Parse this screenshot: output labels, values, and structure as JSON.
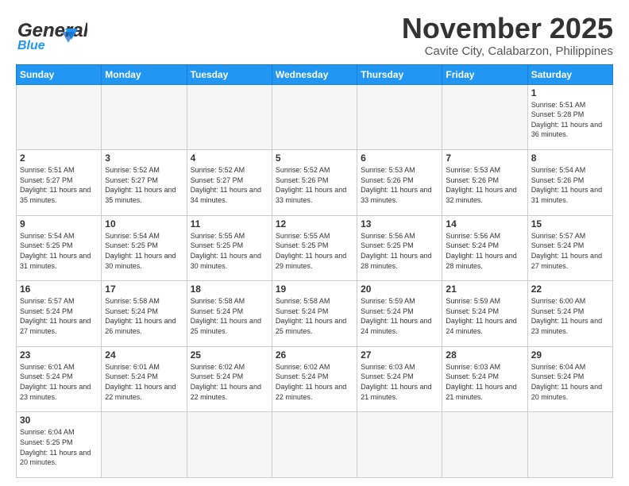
{
  "header": {
    "logo_general": "General",
    "logo_blue": "Blue",
    "month": "November 2025",
    "location": "Cavite City, Calabarzon, Philippines"
  },
  "days_of_week": [
    "Sunday",
    "Monday",
    "Tuesday",
    "Wednesday",
    "Thursday",
    "Friday",
    "Saturday"
  ],
  "weeks": [
    [
      {
        "day": "",
        "sunrise": "",
        "sunset": "",
        "daylight": "",
        "empty": true
      },
      {
        "day": "",
        "sunrise": "",
        "sunset": "",
        "daylight": "",
        "empty": true
      },
      {
        "day": "",
        "sunrise": "",
        "sunset": "",
        "daylight": "",
        "empty": true
      },
      {
        "day": "",
        "sunrise": "",
        "sunset": "",
        "daylight": "",
        "empty": true
      },
      {
        "day": "",
        "sunrise": "",
        "sunset": "",
        "daylight": "",
        "empty": true
      },
      {
        "day": "",
        "sunrise": "",
        "sunset": "",
        "daylight": "",
        "empty": true
      },
      {
        "day": "1",
        "sunrise": "Sunrise: 5:51 AM",
        "sunset": "Sunset: 5:28 PM",
        "daylight": "Daylight: 11 hours and 36 minutes.",
        "empty": false
      }
    ],
    [
      {
        "day": "2",
        "sunrise": "Sunrise: 5:51 AM",
        "sunset": "Sunset: 5:27 PM",
        "daylight": "Daylight: 11 hours and 35 minutes.",
        "empty": false
      },
      {
        "day": "3",
        "sunrise": "Sunrise: 5:52 AM",
        "sunset": "Sunset: 5:27 PM",
        "daylight": "Daylight: 11 hours and 35 minutes.",
        "empty": false
      },
      {
        "day": "4",
        "sunrise": "Sunrise: 5:52 AM",
        "sunset": "Sunset: 5:27 PM",
        "daylight": "Daylight: 11 hours and 34 minutes.",
        "empty": false
      },
      {
        "day": "5",
        "sunrise": "Sunrise: 5:52 AM",
        "sunset": "Sunset: 5:26 PM",
        "daylight": "Daylight: 11 hours and 33 minutes.",
        "empty": false
      },
      {
        "day": "6",
        "sunrise": "Sunrise: 5:53 AM",
        "sunset": "Sunset: 5:26 PM",
        "daylight": "Daylight: 11 hours and 33 minutes.",
        "empty": false
      },
      {
        "day": "7",
        "sunrise": "Sunrise: 5:53 AM",
        "sunset": "Sunset: 5:26 PM",
        "daylight": "Daylight: 11 hours and 32 minutes.",
        "empty": false
      },
      {
        "day": "8",
        "sunrise": "Sunrise: 5:54 AM",
        "sunset": "Sunset: 5:26 PM",
        "daylight": "Daylight: 11 hours and 31 minutes.",
        "empty": false
      }
    ],
    [
      {
        "day": "9",
        "sunrise": "Sunrise: 5:54 AM",
        "sunset": "Sunset: 5:25 PM",
        "daylight": "Daylight: 11 hours and 31 minutes.",
        "empty": false
      },
      {
        "day": "10",
        "sunrise": "Sunrise: 5:54 AM",
        "sunset": "Sunset: 5:25 PM",
        "daylight": "Daylight: 11 hours and 30 minutes.",
        "empty": false
      },
      {
        "day": "11",
        "sunrise": "Sunrise: 5:55 AM",
        "sunset": "Sunset: 5:25 PM",
        "daylight": "Daylight: 11 hours and 30 minutes.",
        "empty": false
      },
      {
        "day": "12",
        "sunrise": "Sunrise: 5:55 AM",
        "sunset": "Sunset: 5:25 PM",
        "daylight": "Daylight: 11 hours and 29 minutes.",
        "empty": false
      },
      {
        "day": "13",
        "sunrise": "Sunrise: 5:56 AM",
        "sunset": "Sunset: 5:25 PM",
        "daylight": "Daylight: 11 hours and 28 minutes.",
        "empty": false
      },
      {
        "day": "14",
        "sunrise": "Sunrise: 5:56 AM",
        "sunset": "Sunset: 5:24 PM",
        "daylight": "Daylight: 11 hours and 28 minutes.",
        "empty": false
      },
      {
        "day": "15",
        "sunrise": "Sunrise: 5:57 AM",
        "sunset": "Sunset: 5:24 PM",
        "daylight": "Daylight: 11 hours and 27 minutes.",
        "empty": false
      }
    ],
    [
      {
        "day": "16",
        "sunrise": "Sunrise: 5:57 AM",
        "sunset": "Sunset: 5:24 PM",
        "daylight": "Daylight: 11 hours and 27 minutes.",
        "empty": false
      },
      {
        "day": "17",
        "sunrise": "Sunrise: 5:58 AM",
        "sunset": "Sunset: 5:24 PM",
        "daylight": "Daylight: 11 hours and 26 minutes.",
        "empty": false
      },
      {
        "day": "18",
        "sunrise": "Sunrise: 5:58 AM",
        "sunset": "Sunset: 5:24 PM",
        "daylight": "Daylight: 11 hours and 25 minutes.",
        "empty": false
      },
      {
        "day": "19",
        "sunrise": "Sunrise: 5:58 AM",
        "sunset": "Sunset: 5:24 PM",
        "daylight": "Daylight: 11 hours and 25 minutes.",
        "empty": false
      },
      {
        "day": "20",
        "sunrise": "Sunrise: 5:59 AM",
        "sunset": "Sunset: 5:24 PM",
        "daylight": "Daylight: 11 hours and 24 minutes.",
        "empty": false
      },
      {
        "day": "21",
        "sunrise": "Sunrise: 5:59 AM",
        "sunset": "Sunset: 5:24 PM",
        "daylight": "Daylight: 11 hours and 24 minutes.",
        "empty": false
      },
      {
        "day": "22",
        "sunrise": "Sunrise: 6:00 AM",
        "sunset": "Sunset: 5:24 PM",
        "daylight": "Daylight: 11 hours and 23 minutes.",
        "empty": false
      }
    ],
    [
      {
        "day": "23",
        "sunrise": "Sunrise: 6:01 AM",
        "sunset": "Sunset: 5:24 PM",
        "daylight": "Daylight: 11 hours and 23 minutes.",
        "empty": false
      },
      {
        "day": "24",
        "sunrise": "Sunrise: 6:01 AM",
        "sunset": "Sunset: 5:24 PM",
        "daylight": "Daylight: 11 hours and 22 minutes.",
        "empty": false
      },
      {
        "day": "25",
        "sunrise": "Sunrise: 6:02 AM",
        "sunset": "Sunset: 5:24 PM",
        "daylight": "Daylight: 11 hours and 22 minutes.",
        "empty": false
      },
      {
        "day": "26",
        "sunrise": "Sunrise: 6:02 AM",
        "sunset": "Sunset: 5:24 PM",
        "daylight": "Daylight: 11 hours and 22 minutes.",
        "empty": false
      },
      {
        "day": "27",
        "sunrise": "Sunrise: 6:03 AM",
        "sunset": "Sunset: 5:24 PM",
        "daylight": "Daylight: 11 hours and 21 minutes.",
        "empty": false
      },
      {
        "day": "28",
        "sunrise": "Sunrise: 6:03 AM",
        "sunset": "Sunset: 5:24 PM",
        "daylight": "Daylight: 11 hours and 21 minutes.",
        "empty": false
      },
      {
        "day": "29",
        "sunrise": "Sunrise: 6:04 AM",
        "sunset": "Sunset: 5:24 PM",
        "daylight": "Daylight: 11 hours and 20 minutes.",
        "empty": false
      }
    ],
    [
      {
        "day": "30",
        "sunrise": "Sunrise: 6:04 AM",
        "sunset": "Sunset: 5:25 PM",
        "daylight": "Daylight: 11 hours and 20 minutes.",
        "empty": false
      },
      {
        "day": "",
        "sunrise": "",
        "sunset": "",
        "daylight": "",
        "empty": true
      },
      {
        "day": "",
        "sunrise": "",
        "sunset": "",
        "daylight": "",
        "empty": true
      },
      {
        "day": "",
        "sunrise": "",
        "sunset": "",
        "daylight": "",
        "empty": true
      },
      {
        "day": "",
        "sunrise": "",
        "sunset": "",
        "daylight": "",
        "empty": true
      },
      {
        "day": "",
        "sunrise": "",
        "sunset": "",
        "daylight": "",
        "empty": true
      },
      {
        "day": "",
        "sunrise": "",
        "sunset": "",
        "daylight": "",
        "empty": true
      }
    ]
  ]
}
